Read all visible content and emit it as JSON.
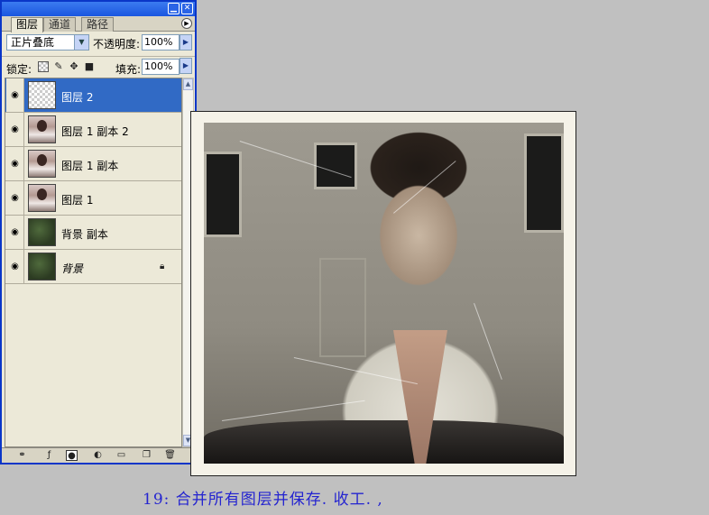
{
  "palette": {
    "tabs": [
      {
        "label": "图层"
      },
      {
        "label": "通道"
      },
      {
        "label": "路径"
      }
    ],
    "blend_mode": "正片叠底",
    "opacity_label": "不透明度:",
    "opacity_value": "100%",
    "lock_label": "锁定:",
    "fill_label": "填充:",
    "fill_value": "100%",
    "layers": [
      {
        "name": "图层 2",
        "selected": true,
        "thumb": "transparent"
      },
      {
        "name": "图层 1 副本 2",
        "thumb": "photo"
      },
      {
        "name": "图层 1 副本",
        "thumb": "photo"
      },
      {
        "name": "图层 1",
        "thumb": "photo"
      },
      {
        "name": "背景 副本",
        "thumb": "green-texture"
      },
      {
        "name": "背景",
        "thumb": "green-texture",
        "locked": true
      }
    ],
    "icons": {
      "minimize": "minimize-icon",
      "close": "close-icon",
      "menu": "palette-menu-icon",
      "eye": "eye-icon",
      "lock": "lock-icon"
    },
    "selection_color": "#316ac5",
    "titlebar_color": "#1a56e0"
  },
  "caption": {
    "text": "19: 合并所有图层并保存. 收工. ,",
    "color": "#2424d0"
  }
}
